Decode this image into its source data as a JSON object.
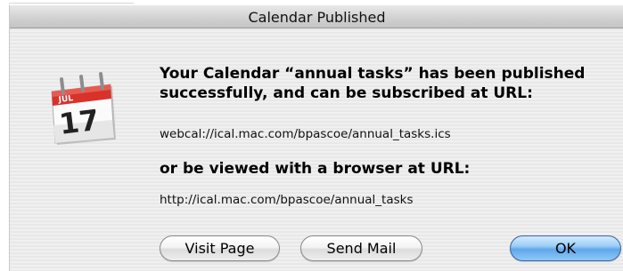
{
  "window": {
    "title": "Calendar Published"
  },
  "icon": {
    "name": "ical-calendar-icon",
    "month": "JUL",
    "day": "17",
    "colors": {
      "tab": "#d8322b",
      "page": "#ffffff",
      "ring": "#9a9a9a"
    }
  },
  "message": {
    "headline": "Your Calendar “annual tasks” has been published successfully, and can be subscribed at URL:",
    "subscribe_url": "webcal://ical.mac.com/bpascoe/annual_tasks.ics",
    "browser_line": "or be viewed with a browser at URL:",
    "browser_url": "http://ical.mac.com/bpascoe/annual_tasks"
  },
  "buttons": {
    "visit": "Visit Page",
    "mail": "Send Mail",
    "ok": "OK"
  },
  "colors": {
    "default_button": "#5fa6ea",
    "dialog_bg": "#ececec"
  }
}
